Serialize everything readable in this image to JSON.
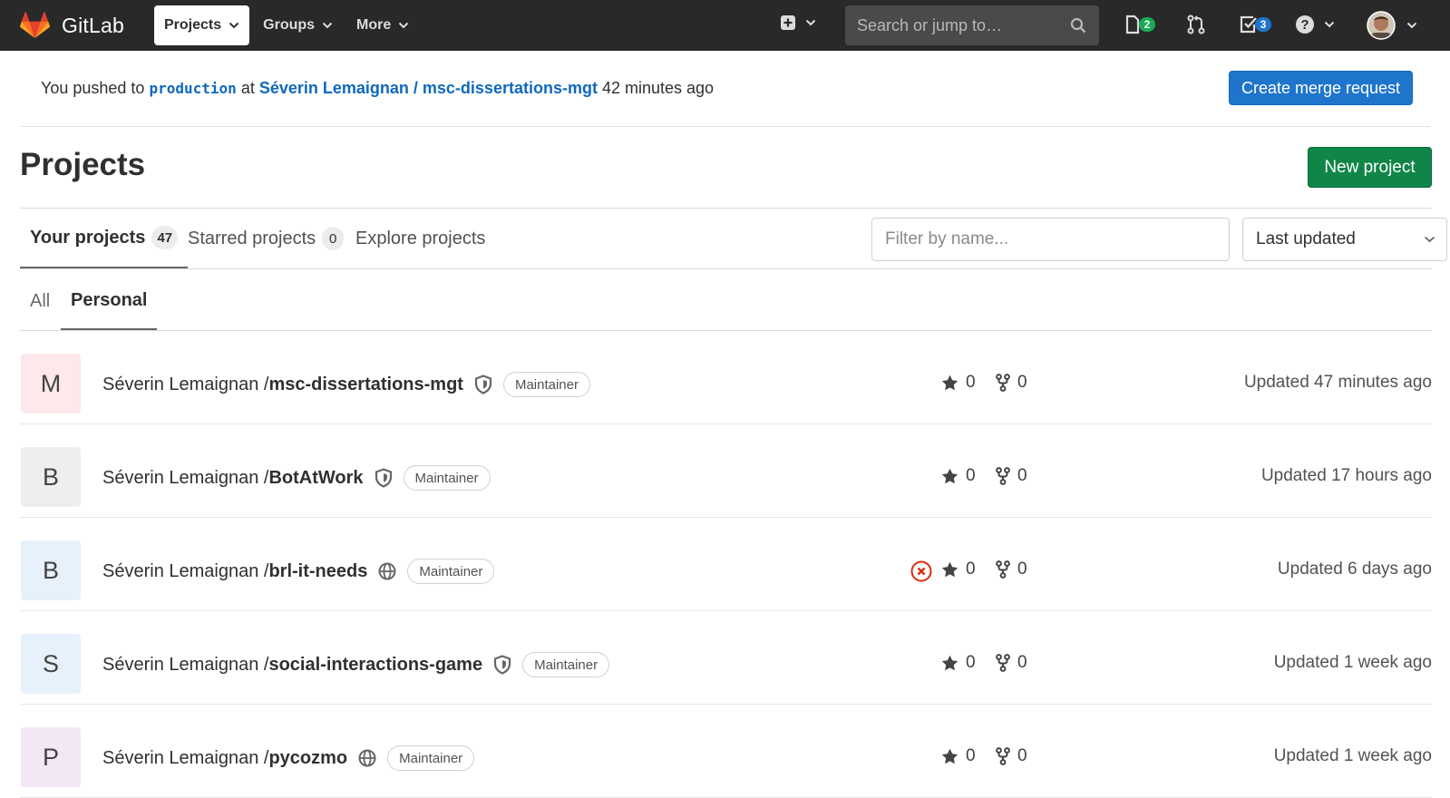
{
  "navbar": {
    "brand": "GitLab",
    "items": [
      {
        "label": "Projects",
        "active": true
      },
      {
        "label": "Groups",
        "active": false
      },
      {
        "label": "More",
        "active": false
      }
    ],
    "search_placeholder": "Search or jump to…",
    "issues_count": "2",
    "todos_count": "3",
    "colors": {
      "bg": "#292929",
      "issues_badge": "#1aaa55",
      "todos_badge": "#1f75cb"
    }
  },
  "push_banner": {
    "prefix": "You pushed to",
    "branch": "production",
    "at": "at",
    "project": "Séverin Lemaignan / msc-dissertations-mgt",
    "time": "42 minutes ago",
    "button": "Create merge request"
  },
  "page": {
    "title": "Projects",
    "new_project": "New project"
  },
  "tabs": [
    {
      "label": "Your projects",
      "count": "47",
      "active": true
    },
    {
      "label": "Starred projects",
      "count": "0",
      "active": false
    },
    {
      "label": "Explore projects",
      "count": null,
      "active": false
    }
  ],
  "filter": {
    "placeholder": "Filter by name...",
    "sort": "Last updated"
  },
  "subtabs": [
    {
      "label": "All",
      "active": false
    },
    {
      "label": "Personal",
      "active": true
    }
  ],
  "projects": [
    {
      "letter": "M",
      "avatar_color": "#fde8ec",
      "namespace": "Séverin Lemaignan / ",
      "name": "msc-dissertations-mgt",
      "visibility": "shield-icon",
      "role": "Maintainer",
      "pipeline_failed": false,
      "stars": "0",
      "forks": "0",
      "updated": "Updated 47 minutes ago"
    },
    {
      "letter": "B",
      "avatar_color": "#eeeeee",
      "namespace": "Séverin Lemaignan / ",
      "name": "BotAtWork",
      "visibility": "shield-icon",
      "role": "Maintainer",
      "pipeline_failed": false,
      "stars": "0",
      "forks": "0",
      "updated": "Updated 17 hours ago"
    },
    {
      "letter": "B",
      "avatar_color": "#e6f1fb",
      "namespace": "Séverin Lemaignan / ",
      "name": "brl-it-needs",
      "visibility": "globe-icon",
      "role": "Maintainer",
      "pipeline_failed": true,
      "stars": "0",
      "forks": "0",
      "updated": "Updated 6 days ago"
    },
    {
      "letter": "S",
      "avatar_color": "#e6f1fb",
      "namespace": "Séverin Lemaignan / ",
      "name": "social-interactions-game",
      "visibility": "shield-icon",
      "role": "Maintainer",
      "pipeline_failed": false,
      "stars": "0",
      "forks": "0",
      "updated": "Updated 1 week ago"
    },
    {
      "letter": "P",
      "avatar_color": "#f3e6f5",
      "namespace": "Séverin Lemaignan / ",
      "name": "pycozmo",
      "visibility": "globe-icon",
      "role": "Maintainer",
      "pipeline_failed": false,
      "stars": "0",
      "forks": "0",
      "updated": "Updated 1 week ago"
    }
  ]
}
